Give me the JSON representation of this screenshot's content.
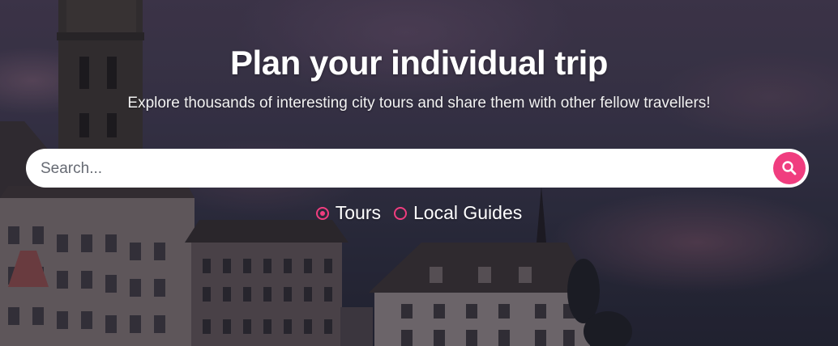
{
  "hero": {
    "title": "Plan your individual trip",
    "subtitle": "Explore thousands of interesting city tours and share them with other fellow travellers!"
  },
  "search": {
    "placeholder": "Search...",
    "value": "",
    "button_icon": "search-icon"
  },
  "search_type": {
    "options": [
      {
        "label": "Tours",
        "checked": true
      },
      {
        "label": "Local Guides",
        "checked": false
      }
    ]
  },
  "colors": {
    "accent": "#f03d7f",
    "text": "#ffffff",
    "search_background": "#ffffff"
  },
  "background_image": "city-skyline-dusk"
}
